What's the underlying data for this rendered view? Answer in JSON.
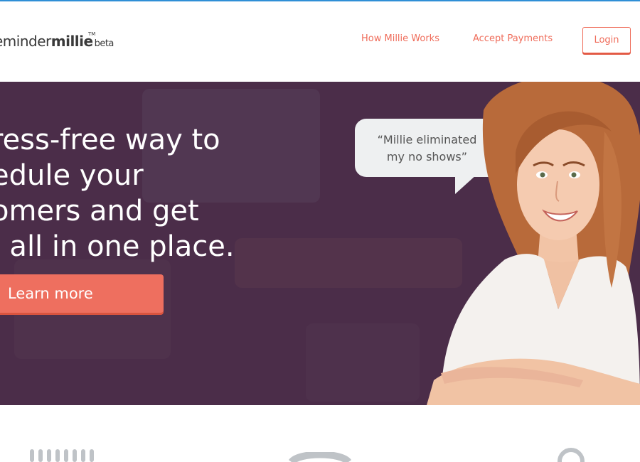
{
  "brand": {
    "logo_part1": "eminder",
    "logo_part2": "millie",
    "logo_tm": "TM",
    "logo_beta": "beta"
  },
  "nav": {
    "how_label": "How Millie Works",
    "accept_label": "Accept Payments",
    "login_label": "Login"
  },
  "hero": {
    "headline": "ress-free way to\nedule your\nomers and get\n, all in one place.",
    "cta_label": "Learn more",
    "quote_line1": "“Millie eliminated",
    "quote_line2": "my no shows”"
  },
  "colors": {
    "accent": "#ef6c5a",
    "hero_bg": "#4b2d49",
    "top_strip": "#2f8fd6",
    "bubble_bg": "#eef0f1"
  },
  "icons": {
    "feature_left": "calendar-spiral-icon",
    "feature_center": "payment-circle-icon",
    "feature_right": "search-icon"
  }
}
